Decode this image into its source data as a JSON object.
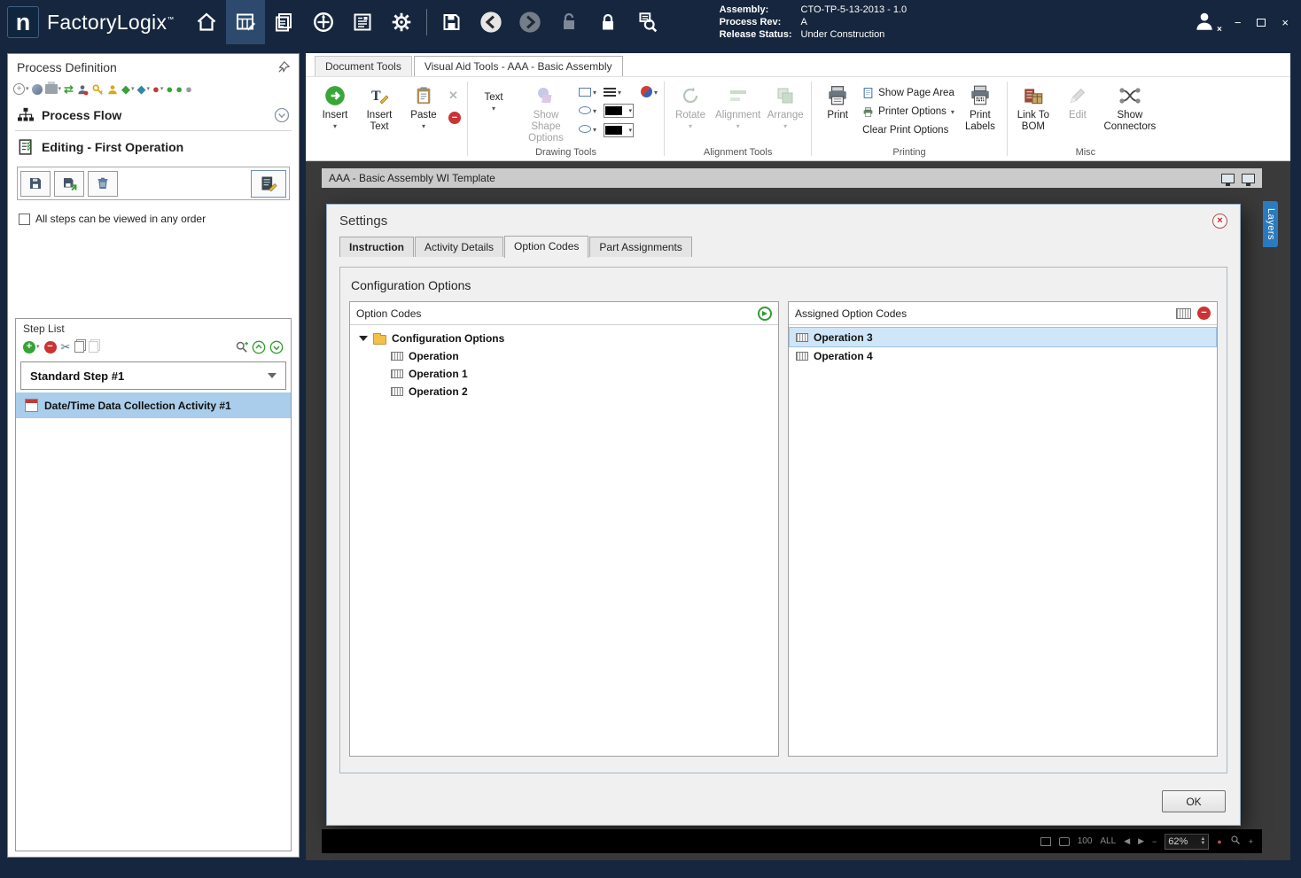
{
  "titlebar": {
    "app_name": "FactoryLogix",
    "trademark": "™",
    "info": {
      "assembly_label": "Assembly:",
      "assembly_value": "CTO-TP-5-13-2013 - 1.0",
      "process_rev_label": "Process Rev:",
      "process_rev_value": "A",
      "release_status_label": "Release Status:",
      "release_status_value": "Under Construction"
    }
  },
  "sidebar": {
    "title": "Process Definition",
    "process_flow": "Process Flow",
    "editing": "Editing - First Operation",
    "order_checkbox": "All steps can be viewed in any order",
    "step_list": {
      "title": "Step List",
      "step": "Standard Step #1",
      "activity": "Date/Time Data Collection Activity #1"
    }
  },
  "ribbon": {
    "tabs": [
      {
        "label": "Document Tools"
      },
      {
        "label": "Visual Aid Tools - AAA - Basic Assembly"
      }
    ],
    "buttons": {
      "insert": "Insert",
      "insert_text": "Insert Text",
      "paste": "Paste",
      "text": "Text",
      "show_shape_options": "Show Shape Options",
      "rotate": "Rotate",
      "alignment": "Alignment",
      "arrange": "Arrange",
      "print": "Print",
      "show_page_area": "Show Page Area",
      "printer_options": "Printer Options",
      "clear_print_options": "Clear Print Options",
      "print_labels": "Print Labels",
      "link_to_bom": "Link To BOM",
      "edit": "Edit",
      "show_connectors": "Show Connectors"
    },
    "groups": {
      "drawing": "Drawing Tools",
      "alignment": "Alignment Tools",
      "printing": "Printing",
      "misc": "Misc"
    }
  },
  "document": {
    "title": "AAA - Basic Assembly WI Template",
    "layers_tab": "Layers",
    "statusbar": {
      "fit_100": "100",
      "fit_all": "ALL",
      "zoom": "62%"
    }
  },
  "dialog": {
    "title": "Settings",
    "tabs": [
      {
        "label": "Instruction"
      },
      {
        "label": "Activity Details"
      },
      {
        "label": "Option Codes"
      },
      {
        "label": "Part Assignments"
      }
    ],
    "heading": "Configuration Options",
    "option_codes": {
      "header": "Option Codes",
      "root": "Configuration Options",
      "items": [
        {
          "label": "Operation"
        },
        {
          "label": "Operation 1"
        },
        {
          "label": "Operation 2"
        }
      ]
    },
    "assigned": {
      "header": "Assigned Option Codes",
      "items": [
        {
          "label": "Operation 3"
        },
        {
          "label": "Operation 4"
        }
      ]
    },
    "ok": "OK"
  },
  "icons": {
    "accent_green": "#36a336",
    "accent_red": "#cc3333",
    "selection_blue": "#a9cdeb",
    "dialog_selection_blue": "#cfe6f8",
    "titlebar_navy": "#16263e",
    "layers_tab_blue": "#2b7bc0"
  }
}
